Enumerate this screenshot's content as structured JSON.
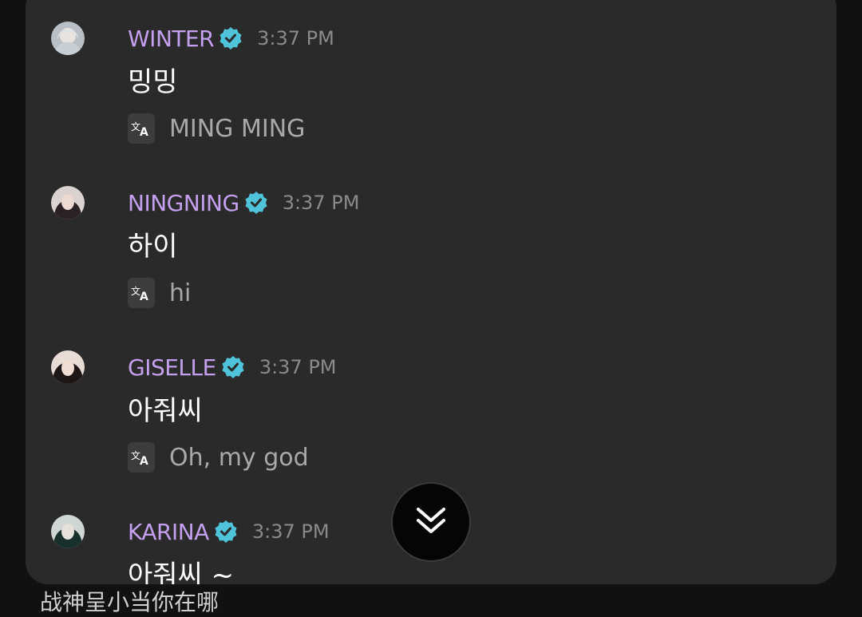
{
  "messages": [
    {
      "author": "WINTER",
      "time": "3:37 PM",
      "text": "밍밍",
      "translation": "MING MING"
    },
    {
      "author": "NINGNING",
      "time": "3:37 PM",
      "text": "하이",
      "translation": "hi"
    },
    {
      "author": "GISELLE",
      "time": "3:37 PM",
      "text": "아줘씨",
      "translation": "Oh, my god"
    },
    {
      "author": "KARINA",
      "time": "3:37 PM",
      "text": "아줘씨 ~",
      "translation": ""
    }
  ],
  "background_text": "战神呈小当你在哪",
  "icons": {
    "verified": "verified-badge-icon",
    "translate": "translate-icon",
    "scroll": "double-chevron-down-icon"
  },
  "colors": {
    "panel": "#2a2a2a",
    "name": "#c3a1ee",
    "verified": "#4fc3d9",
    "time": "#8a8a8a"
  }
}
